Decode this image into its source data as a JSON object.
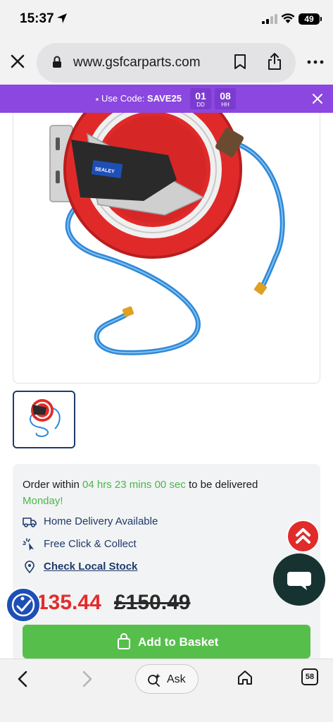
{
  "status_bar": {
    "time": "15:37",
    "battery": "49"
  },
  "browser": {
    "url": "www.gsfcarparts.com",
    "tab_count": "58"
  },
  "promo": {
    "text_prefix": "Use Code: ",
    "code": "SAVE25",
    "countdown": [
      {
        "value": "01",
        "unit": "DD"
      },
      {
        "value": "08",
        "unit": "HH"
      }
    ]
  },
  "product": {
    "brand_badge": "SEALEY"
  },
  "delivery": {
    "order_prefix": "Order within ",
    "time_left": "04 hrs 23 mins 00 sec",
    "order_suffix": " to be delivered",
    "day": "Monday!",
    "home_delivery": "Home Delivery Available",
    "click_collect": "Free Click & Collect",
    "local_stock": "Check Local Stock"
  },
  "price": {
    "current": "135.44",
    "was": "£150.49"
  },
  "actions": {
    "add_to_basket": "Add to Basket"
  },
  "bottom_bar": {
    "ask_label": "Ask"
  },
  "colors": {
    "promo_bg": "#8b47e0",
    "price_red": "#e52b2b",
    "basket_green": "#56bf4b",
    "navy": "#1e3a6b",
    "delivery_green": "#47b84a"
  },
  "icons": [
    "location-arrow-icon",
    "signal-icon",
    "wifi-icon",
    "battery-icon",
    "close-icon",
    "lock-icon",
    "bookmark-icon",
    "share-icon",
    "more-icon",
    "truck-icon",
    "click-collect-icon",
    "map-pin-icon",
    "double-chevron-up-icon",
    "chat-bubble-icon",
    "accessibility-icon",
    "basket-icon",
    "chevron-left-icon",
    "chevron-right-icon",
    "ask-sparkle-icon",
    "home-icon"
  ]
}
